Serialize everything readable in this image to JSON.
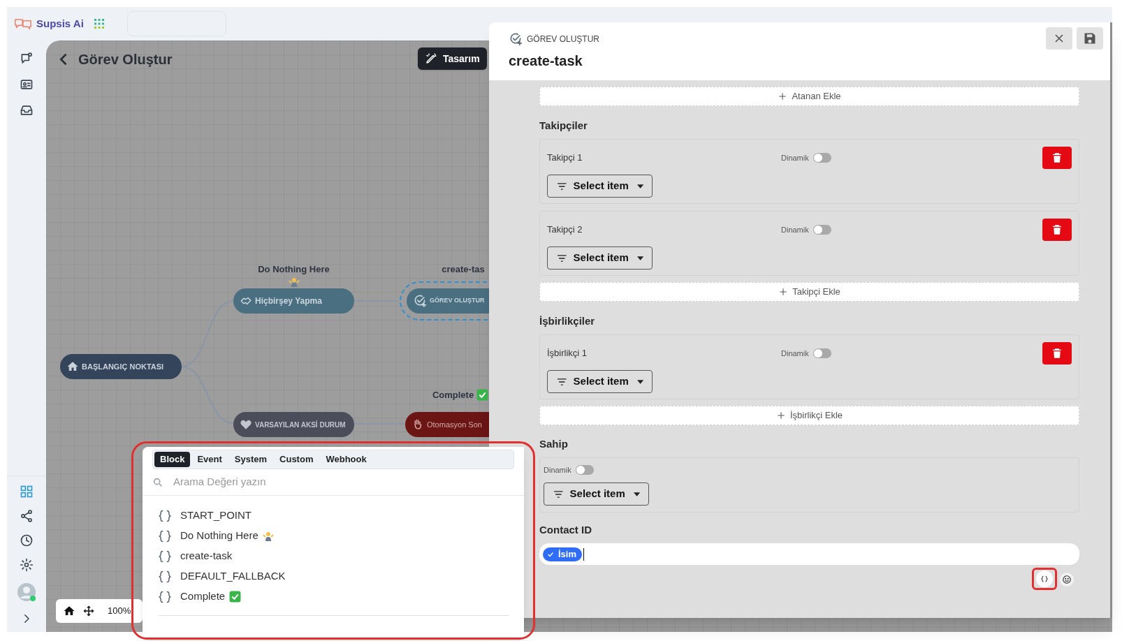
{
  "app": {
    "brand": "Supsis Ai"
  },
  "canvas": {
    "title": "Görev Oluştur",
    "design_button": "Tasarım",
    "zoom": "100%",
    "nodes": [
      {
        "kind": "start",
        "label": "BAŞLANGIÇ NOKTASI",
        "selected": false
      },
      {
        "kind": "action",
        "label": "Hiçbirşey Yapma",
        "caption": "Do Nothing Here",
        "selected": false
      },
      {
        "kind": "task",
        "label": "GÖREV OLUŞTUR",
        "caption": "create-tas",
        "selected": true
      },
      {
        "kind": "fallback",
        "label": "VARSAYILAN AKSİ DURUM",
        "selected": false
      },
      {
        "kind": "end",
        "label": "Otomasyon Son",
        "caption": "Complete",
        "selected": false
      }
    ]
  },
  "variable_picker": {
    "tabs": [
      {
        "label": "Block",
        "selected": true
      },
      {
        "label": "Event",
        "selected": false
      },
      {
        "label": "System",
        "selected": false
      },
      {
        "label": "Custom",
        "selected": false
      },
      {
        "label": "Webhook",
        "selected": false
      }
    ],
    "search": {
      "placeholder": "Arama Değeri yazın"
    },
    "items": [
      {
        "label": "START_POINT",
        "kind": "plain"
      },
      {
        "label": "Do Nothing Here",
        "kind": "shrug"
      },
      {
        "label": "create-task",
        "kind": "plain"
      },
      {
        "label": "DEFAULT_FALLBACK",
        "kind": "plain"
      },
      {
        "label": "Complete",
        "kind": "check"
      }
    ]
  },
  "panel": {
    "type": "GÖREV OLUŞTUR",
    "name": "create-task",
    "add_assignee": "Atanan Ekle",
    "followers": {
      "title": "Takipçiler",
      "add": "Takipçi Ekle",
      "items": [
        {
          "label": "Takipçi 1",
          "toggle_label": "Dinamik",
          "on": false,
          "select": "Select item"
        },
        {
          "label": "Takipçi 2",
          "toggle_label": "Dinamik",
          "on": false,
          "select": "Select item"
        }
      ]
    },
    "collaborators": {
      "title": "İşbirlikçiler",
      "add": "İşbirlikçi Ekle",
      "items": [
        {
          "label": "İşbirlikçi 1",
          "toggle_label": "Dinamik",
          "on": false,
          "select": "Select item"
        }
      ]
    },
    "owner": {
      "title": "Sahip",
      "toggle_label": "Dinamik",
      "on": false,
      "select": "Select item"
    },
    "contact_id": {
      "label": "Contact ID",
      "chips": [
        "İsim"
      ]
    }
  }
}
